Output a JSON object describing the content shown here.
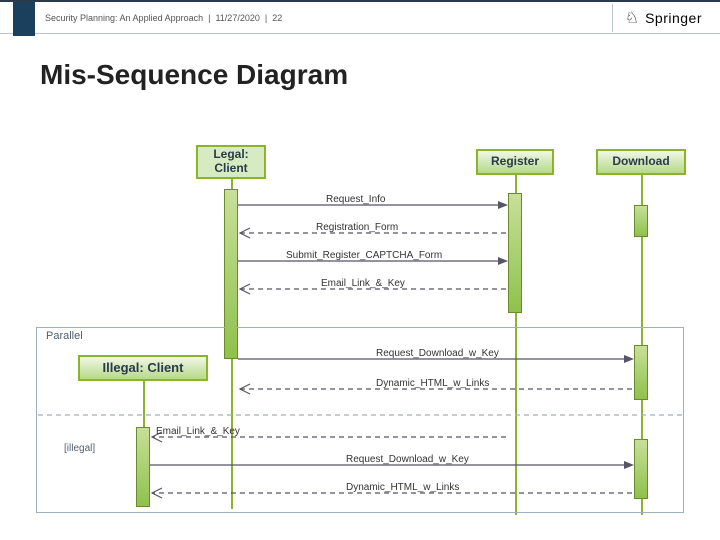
{
  "header": {
    "doc_title": "Security Planning: An Applied Approach",
    "date": "11/27/2020",
    "page": "22",
    "brand_name": "Springer"
  },
  "title": "Mis-Sequence Diagram",
  "nodes": {
    "legal_client": "Legal:\nClient",
    "register": "Register",
    "download": "Download",
    "illegal_client": "Illegal: Client"
  },
  "labels": {
    "parallel": "Parallel",
    "illegal_guard": "[illegal]"
  },
  "messages": {
    "request_info": "Request_Info",
    "registration_form": "Registration_Form",
    "submit_register": "Submit_Register_CAPTCHA_Form",
    "email_link_key": "Email_Link_&_Key",
    "request_download1": "Request_Download_w_Key",
    "dynamic_html1": "Dynamic_HTML_w_Links",
    "email_link_key2": "Email_Link_&_Key",
    "request_download2": "Request_Download_w_Key",
    "dynamic_html2": "Dynamic_HTML_w_Links"
  }
}
